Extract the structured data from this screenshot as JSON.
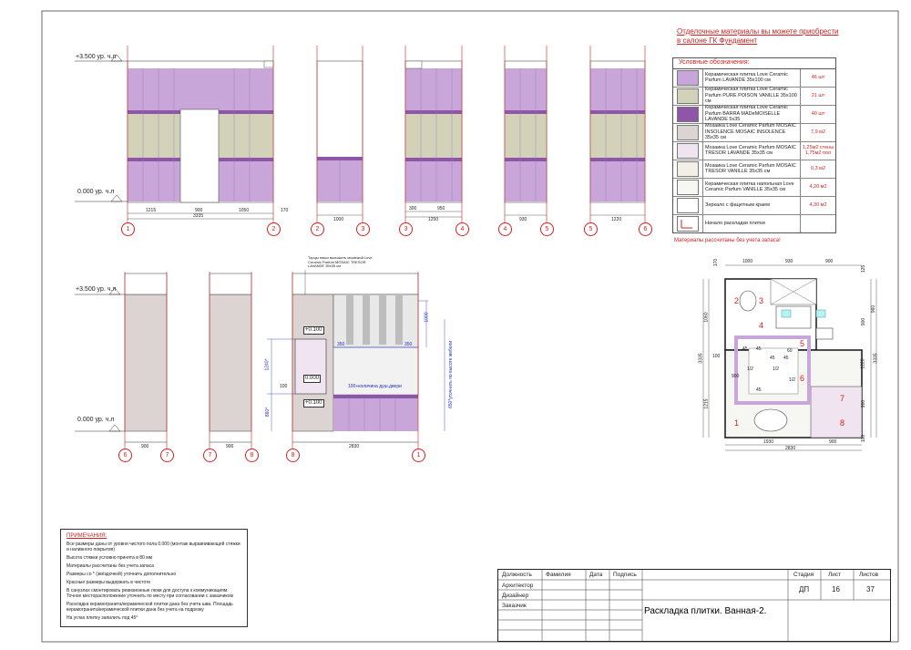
{
  "heading": {
    "line1": "Отделочные материалы вы можете приобрести",
    "line2": "в салоне ГК Фундамент"
  },
  "legend": {
    "title": "Условные обозначения:",
    "items": [
      {
        "text": "Керамическая плитка Love Ceramic Parfum LAVANDE 35х100 см",
        "qty": "46 шт",
        "color": "#c9a6d9"
      },
      {
        "text": "Керамическая плитка Love Ceramic Parfum PURE POISON VANILLE 35х100 см",
        "qty": "21 шт",
        "color": "#d2d2b8"
      },
      {
        "text": "Керамическая плитка Love Ceramic Parfum BARRA MADeMOISELLE LAVANDE 5х35",
        "qty": "40 шт",
        "color": "#8f55a8"
      },
      {
        "text": "Мозаика Love Ceramic Parfum MOSAIC INSOLENCE MOSAIC INSOLENCE 35х35 см",
        "qty": "7,9 м2",
        "color": "#dcd4d2"
      },
      {
        "text": "Мозаика Love Ceramic Parfum MOSAIC TRESOR LAVANDE 35х35 см",
        "qty": "1,25м2 стены 1,75м2 пол",
        "color": "#efe4ef"
      },
      {
        "text": "Мозаика Love Ceramic Parfum MOSAIC TRESOR VANILLE 35х35 см",
        "qty": "0,3 м2",
        "color": "#f1efe6"
      },
      {
        "text": "Керамическая плитка напольная Love Ceramic Parfum VANILLE 35х35 см",
        "qty": "4,20 м2",
        "color": "#f6f6f2"
      },
      {
        "text": "Зеркало с фацетным краем",
        "qty": "4,30 м2",
        "color": "#ffffff"
      },
      {
        "text": "Начало раскладки плитки",
        "qty": "",
        "color": "#ffffff"
      }
    ],
    "calc_note": "Материалы рассчитаны без учета запаса!"
  },
  "levels": {
    "top": "+3.500 ур. ч.л",
    "zero": "0.000 ур. ч.л"
  },
  "elevations_top": [
    {
      "dims": [
        "1215",
        "900",
        "1050"
      ],
      "total": "3335",
      "extra": "170",
      "axes": [
        "1",
        "2"
      ]
    },
    {
      "dims": [
        "1000"
      ],
      "axes": [
        "2",
        "3"
      ]
    },
    {
      "dims": [
        "300",
        "950"
      ],
      "total": "1250",
      "axes": [
        "3",
        "4"
      ]
    },
    {
      "dims": [
        "930"
      ],
      "axes": [
        "4",
        "5"
      ]
    },
    {
      "dims": [
        "1220"
      ],
      "axes": [
        "5",
        "6"
      ]
    }
  ],
  "elevations_bottom": [
    {
      "dims": [
        "900"
      ],
      "axes": [
        "6",
        "7"
      ]
    },
    {
      "dims": [
        "900"
      ],
      "axes": [
        "7",
        "8"
      ]
    },
    {
      "dims": [
        "2830"
      ],
      "axes": [
        "8",
        "1"
      ]
    }
  ],
  "elev8": {
    "tags": [
      "+0.100",
      "0.000",
      "+0.100"
    ],
    "dims_blue": [
      "350",
      "350",
      "1000",
      "1240*",
      "860*",
      "100"
    ],
    "shower_note": "100+количина душ.двери",
    "vert_note": "650*уточнить по высоте мебели",
    "top_note": "Торцы ниши выложить мозаикой Love Ceramic Parfum MOSAIC TRESOR LAVANDE 35х35 см"
  },
  "plan": {
    "dims_top": [
      "1000",
      "930",
      "900"
    ],
    "dims_bottom": [
      "1930",
      "900"
    ],
    "total_bottom": "2830",
    "dims_right": [
      "900",
      "1220",
      "3335",
      "900"
    ],
    "dims_left": [
      "3335",
      "1060",
      "1215"
    ],
    "dims_small": [
      "125",
      "170",
      "100",
      "100",
      "960"
    ],
    "zone_numbers": [
      "1",
      "2",
      "3",
      "4",
      "5",
      "6",
      "7",
      "8"
    ],
    "inner_dims": [
      "45",
      "45",
      "45",
      "45",
      "45",
      "1/2",
      "1/2",
      "1/2",
      "60",
      "900"
    ]
  },
  "notes": {
    "title": "ПРИМЕЧАНИЯ:",
    "items": [
      "Все размеры даны от уровня чистого пола 0.000 (монтаж выравнивающей стяжки и наливного покрытия)",
      "Высота стяжки условно принята в 80 мм",
      "Материалы рассчитаны без учета запаса",
      "Размеры со * (звёздочкой) уточнить дополнительно",
      "Красные размеры выдержать в чистоте",
      "В санузлах смонтировать ревизионные люки для доступа к коммуникациям. Точное месторасположение уточнить по месту при согласовании с заказчиком",
      "Раскладка керамогранита/керамической плитки дана без учета шва. Площадь керамогранита/керамической плитки дана без учета на подрезку",
      "На углах плитку запилить под 45°"
    ]
  },
  "title_block": {
    "headers": [
      "Должность",
      "Фамилия",
      "Дата",
      "Подпись"
    ],
    "roles": [
      "Архитектор",
      "Дизайнер",
      "Заказчик"
    ],
    "stage_label": "Стадия",
    "sheet_label": "Лист",
    "sheets_label": "Листов",
    "stage": "ДП",
    "sheet": "16",
    "sheets": "37",
    "title": "Раскладка плитки. Ванная-2."
  }
}
